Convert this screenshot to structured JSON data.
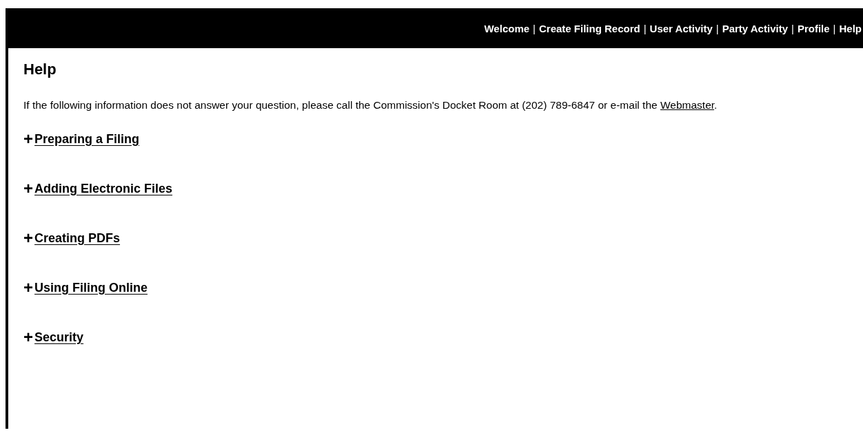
{
  "nav": {
    "links": [
      "Welcome",
      "Create Filing Record",
      "User Activity",
      "Party Activity",
      "Profile",
      "Help"
    ],
    "separator": "|"
  },
  "heading": "Help",
  "intro": {
    "text": "If the following information does not answer your question, please call the Commission's Docket Room at (202) 789-6847 or e-mail the ",
    "link": "Webmaster",
    "end": "."
  },
  "sections": [
    {
      "marker": "+",
      "title": "Preparing a Filing"
    },
    {
      "marker": "+",
      "title": "Adding Electronic Files"
    },
    {
      "marker": "+",
      "title": "Creating PDFs"
    },
    {
      "marker": "+",
      "title": "Using Filing Online"
    },
    {
      "marker": "+",
      "title": "Security"
    }
  ]
}
